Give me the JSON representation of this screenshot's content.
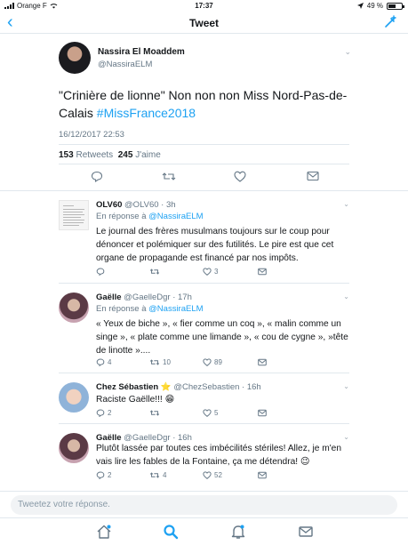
{
  "status_bar": {
    "carrier": "Orange F",
    "time": "17:37",
    "battery": "49 %"
  },
  "nav": {
    "title": "Tweet"
  },
  "main_tweet": {
    "author_name": "Nassira El Moaddem",
    "author_handle": "@NassiraELM",
    "text": "\"Crinière de lionne\" Non non non Miss Nord-Pas-de-Calais ",
    "hashtag": "#MissFrance2018",
    "date": "16/12/2017 22:53",
    "retweets_count": "153",
    "retweets_label": "Retweets",
    "likes_count": "245",
    "likes_label": "J'aime"
  },
  "replies": [
    {
      "name": "OLV60",
      "handle_time": "@OLV60 · 3h",
      "in_reply_prefix": "En réponse à ",
      "in_reply_handle": "@NassiraELM",
      "text": "Le journal des frères musulmans toujours sur le coup pour dénoncer et polémiquer sur des futilités. Le pire est que cet organe de propagande est financé par nos impôts.",
      "replies_count": "",
      "retweets_count": "",
      "likes_count": "3"
    },
    {
      "name": "Gaëlle",
      "handle_time": "@GaelleDgr · 17h",
      "in_reply_prefix": "En réponse à ",
      "in_reply_handle": "@NassiraELM",
      "text": "« Yeux de biche », « fier comme un coq », « malin comme un singe », « plate comme une limande », « cou de cygne », »tête de linotte »....",
      "replies_count": "4",
      "retweets_count": "10",
      "likes_count": "89"
    },
    {
      "name": "Chez Sébastien",
      "name_emoji": "⭐",
      "handle_time": "@ChezSebastien · 16h",
      "text": "Raciste Gaëlle!!! 😁",
      "replies_count": "2",
      "retweets_count": "",
      "likes_count": "5"
    },
    {
      "name": "Gaëlle",
      "handle_time": "@GaelleDgr · 16h",
      "text": "Plutôt lassée par toutes ces imbécilités stériles! Allez, je m'en vais lire les fables de la Fontaine, ça me détendra! 😉",
      "replies_count": "2",
      "retweets_count": "4",
      "likes_count": "52"
    }
  ],
  "composer": {
    "placeholder": "Tweetez votre réponse."
  },
  "colors": {
    "accent": "#1da1f2",
    "text": "#14171a",
    "muted": "#657786",
    "border": "#e1e8ed"
  }
}
